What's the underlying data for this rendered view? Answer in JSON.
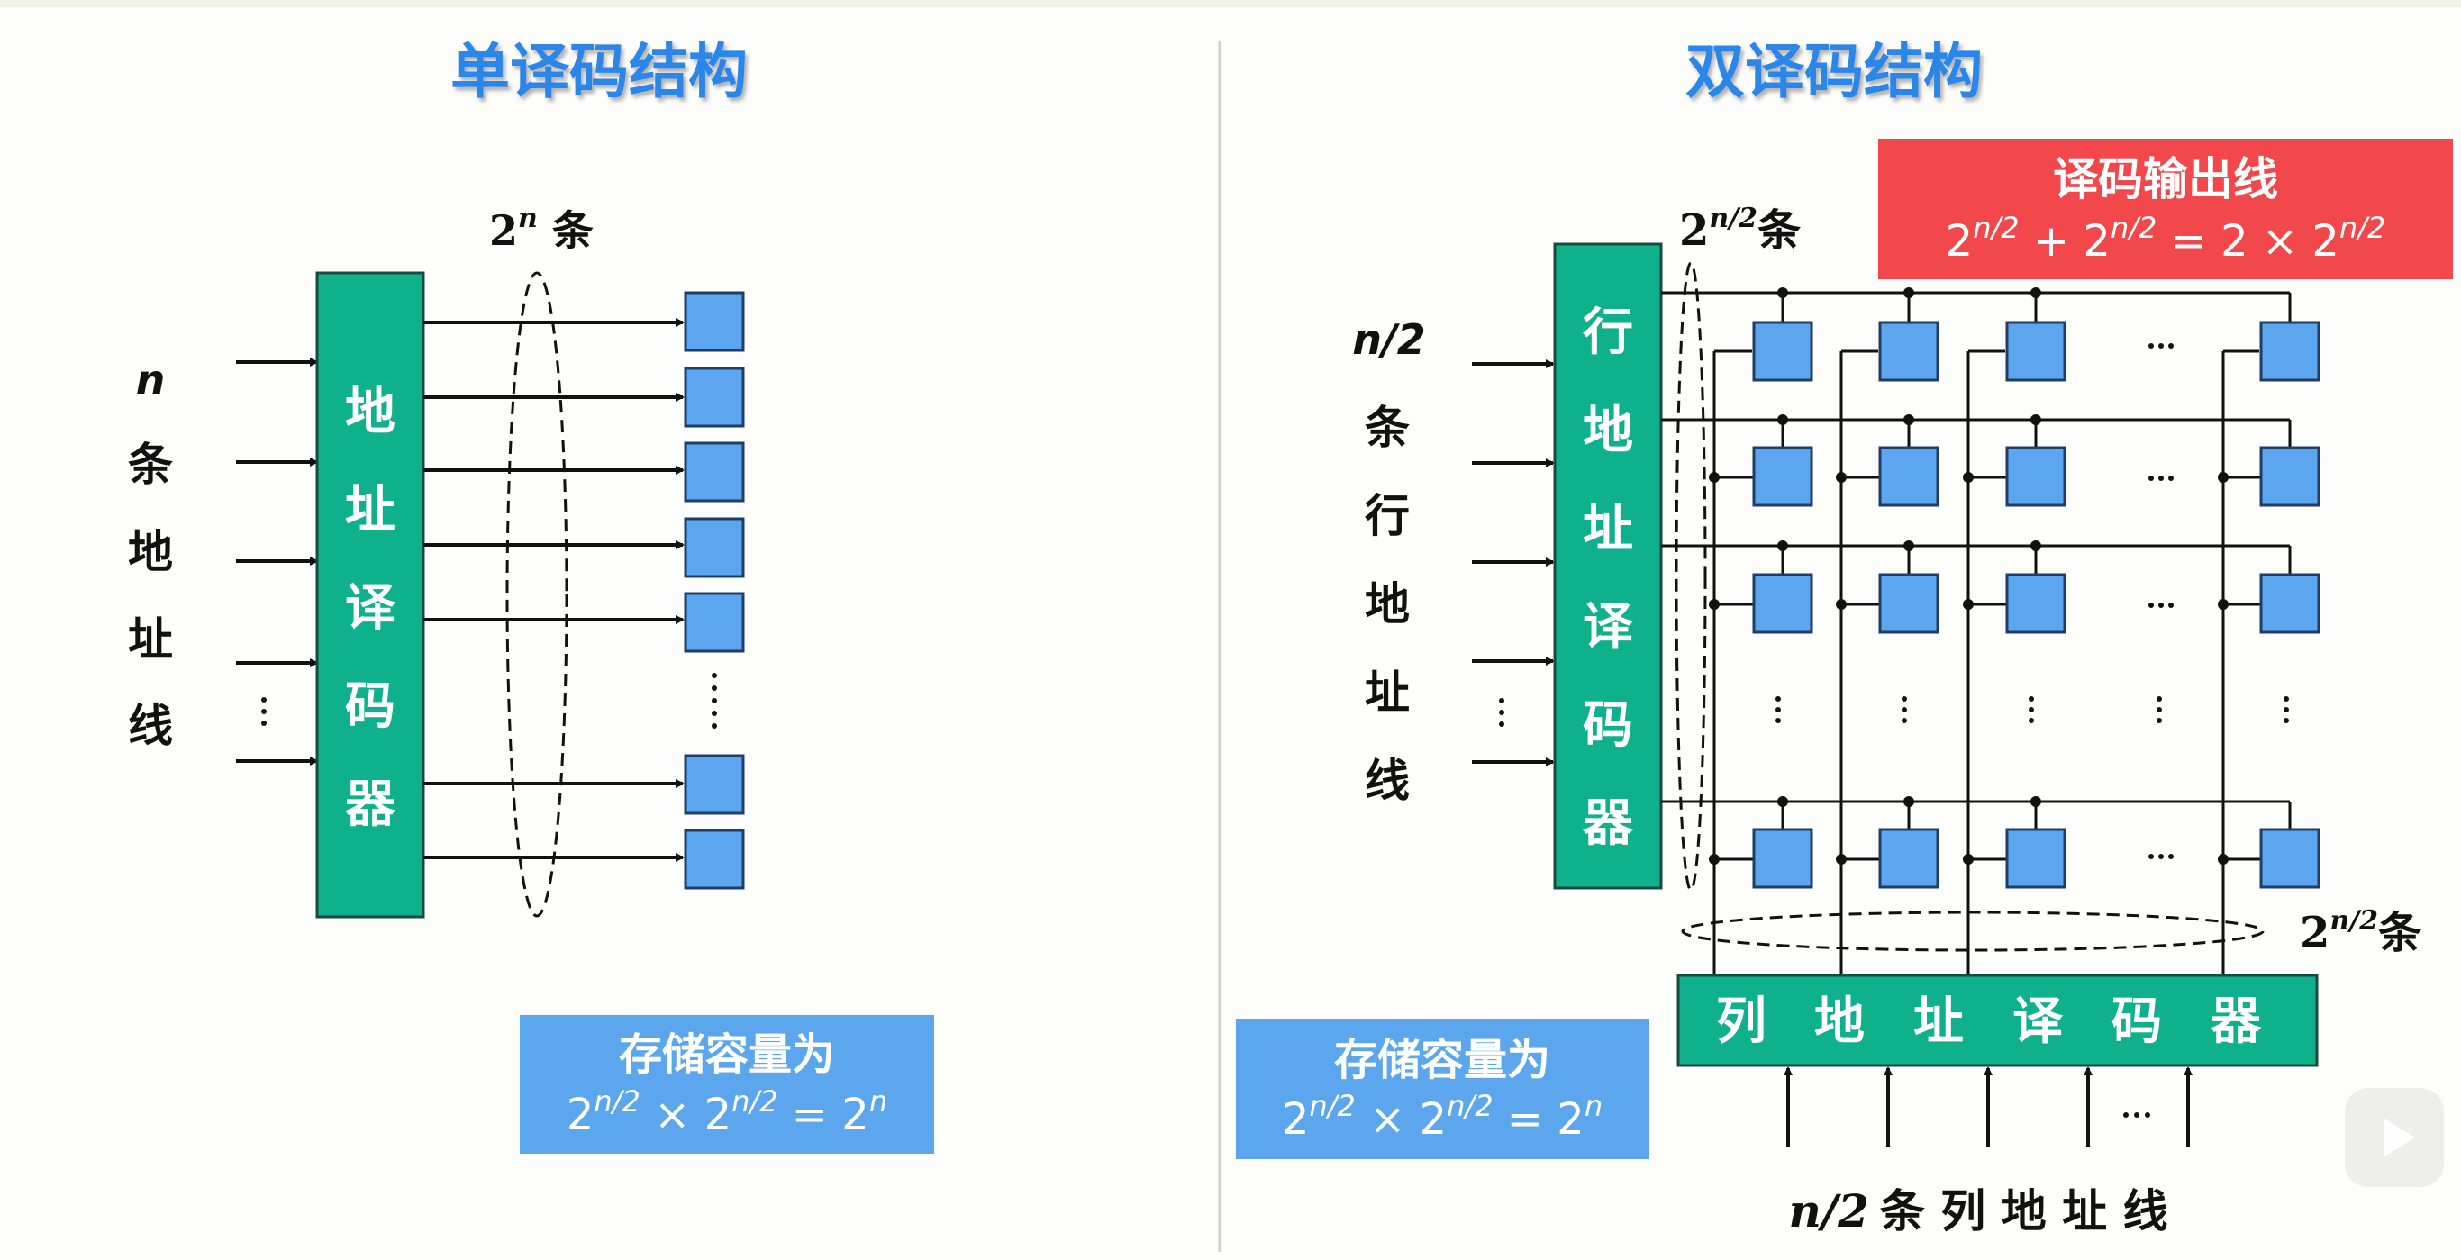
{
  "left_panel": {
    "title": "单译码结构",
    "input_label_n": "n",
    "input_label_chars": [
      "条",
      "地",
      "址",
      "线"
    ],
    "decoder_chars": [
      "地",
      "址",
      "译",
      "码",
      "器"
    ],
    "bundle_label": "条",
    "capacity_title": "存储容量为"
  },
  "right_panel": {
    "title": "双译码结构",
    "row_input_label_n": "n/2",
    "row_input_label_chars": [
      "条",
      "行",
      "地",
      "址",
      "线"
    ],
    "row_decoder_chars": [
      "行",
      "地",
      "址",
      "译",
      "码",
      "器"
    ],
    "row_bundle_suffix": "条",
    "col_bundle_suffix": "条",
    "output_box_title": "译码输出线",
    "capacity_title": "存储容量为",
    "col_decoder_chars": [
      "列",
      "地",
      "址",
      "译",
      "码",
      "器"
    ],
    "col_input_caption_n": "n/2",
    "col_input_caption_text": "条 列 地 址 线"
  },
  "colors": {
    "title": "#2a86e8",
    "decoder": "#0fb08c",
    "cell": "#5ba6ef",
    "capacity_box": "#5ca6ee",
    "output_box": "#f2474b"
  }
}
